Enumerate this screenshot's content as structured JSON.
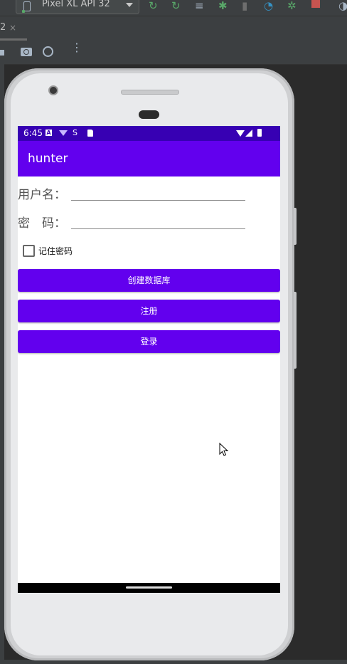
{
  "ide": {
    "device_name": "Pixel XL API 32",
    "tab_fragment": "2",
    "tab_close": "×",
    "icons": [
      "android-device-icon",
      "chevron-down-icon",
      "apply-changes-icon",
      "apply-code-changes-icon",
      "run-coverage-icon",
      "debug-icon",
      "attach-debugger-icon",
      "profiler-icon",
      "run-tests-icon",
      "stop-icon",
      "sync-icon"
    ],
    "colors": {
      "stop": "#c75450",
      "green": "#59a869",
      "blue": "#3592c4"
    }
  },
  "emulator_toolbar": {
    "icons": [
      "stop-square-icon",
      "camera-icon",
      "reset-icon",
      "more-vert-icon"
    ],
    "more": "⋮"
  },
  "status_bar": {
    "time": "6:45",
    "a_icon": "A",
    "s_icon": "S",
    "icons": [
      "notification-a-icon",
      "wifi-sync-icon",
      "s-icon",
      "sd-card-icon",
      "wifi-icon",
      "signal-icon",
      "battery-icon"
    ]
  },
  "app": {
    "title": "hunter",
    "colors": {
      "primary": "#6200ee",
      "primary_dark": "#3700b3"
    }
  },
  "form": {
    "username_label": "用户名：",
    "password_label": "密　码：",
    "username_value": "",
    "password_value": "",
    "remember_label": "记住密码",
    "remember_checked": false
  },
  "buttons": {
    "create_db": "创建数据库",
    "register": "注册",
    "login": "登录"
  }
}
